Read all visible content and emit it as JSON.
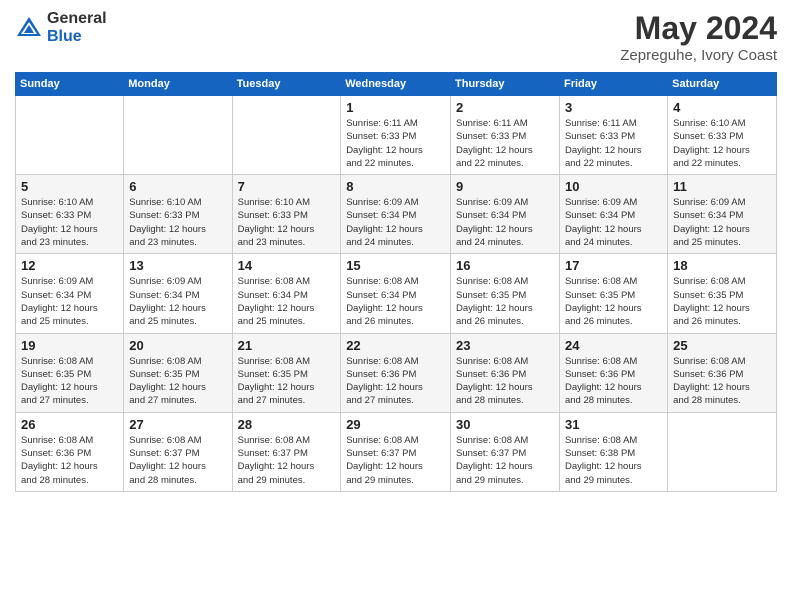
{
  "header": {
    "logo_general": "General",
    "logo_blue": "Blue",
    "month_title": "May 2024",
    "location": "Zepreguhe, Ivory Coast"
  },
  "weekdays": [
    "Sunday",
    "Monday",
    "Tuesday",
    "Wednesday",
    "Thursday",
    "Friday",
    "Saturday"
  ],
  "weeks": [
    [
      {
        "day": "",
        "info": ""
      },
      {
        "day": "",
        "info": ""
      },
      {
        "day": "",
        "info": ""
      },
      {
        "day": "1",
        "info": "Sunrise: 6:11 AM\nSunset: 6:33 PM\nDaylight: 12 hours\nand 22 minutes."
      },
      {
        "day": "2",
        "info": "Sunrise: 6:11 AM\nSunset: 6:33 PM\nDaylight: 12 hours\nand 22 minutes."
      },
      {
        "day": "3",
        "info": "Sunrise: 6:11 AM\nSunset: 6:33 PM\nDaylight: 12 hours\nand 22 minutes."
      },
      {
        "day": "4",
        "info": "Sunrise: 6:10 AM\nSunset: 6:33 PM\nDaylight: 12 hours\nand 22 minutes."
      }
    ],
    [
      {
        "day": "5",
        "info": "Sunrise: 6:10 AM\nSunset: 6:33 PM\nDaylight: 12 hours\nand 23 minutes."
      },
      {
        "day": "6",
        "info": "Sunrise: 6:10 AM\nSunset: 6:33 PM\nDaylight: 12 hours\nand 23 minutes."
      },
      {
        "day": "7",
        "info": "Sunrise: 6:10 AM\nSunset: 6:33 PM\nDaylight: 12 hours\nand 23 minutes."
      },
      {
        "day": "8",
        "info": "Sunrise: 6:09 AM\nSunset: 6:34 PM\nDaylight: 12 hours\nand 24 minutes."
      },
      {
        "day": "9",
        "info": "Sunrise: 6:09 AM\nSunset: 6:34 PM\nDaylight: 12 hours\nand 24 minutes."
      },
      {
        "day": "10",
        "info": "Sunrise: 6:09 AM\nSunset: 6:34 PM\nDaylight: 12 hours\nand 24 minutes."
      },
      {
        "day": "11",
        "info": "Sunrise: 6:09 AM\nSunset: 6:34 PM\nDaylight: 12 hours\nand 25 minutes."
      }
    ],
    [
      {
        "day": "12",
        "info": "Sunrise: 6:09 AM\nSunset: 6:34 PM\nDaylight: 12 hours\nand 25 minutes."
      },
      {
        "day": "13",
        "info": "Sunrise: 6:09 AM\nSunset: 6:34 PM\nDaylight: 12 hours\nand 25 minutes."
      },
      {
        "day": "14",
        "info": "Sunrise: 6:08 AM\nSunset: 6:34 PM\nDaylight: 12 hours\nand 25 minutes."
      },
      {
        "day": "15",
        "info": "Sunrise: 6:08 AM\nSunset: 6:34 PM\nDaylight: 12 hours\nand 26 minutes."
      },
      {
        "day": "16",
        "info": "Sunrise: 6:08 AM\nSunset: 6:35 PM\nDaylight: 12 hours\nand 26 minutes."
      },
      {
        "day": "17",
        "info": "Sunrise: 6:08 AM\nSunset: 6:35 PM\nDaylight: 12 hours\nand 26 minutes."
      },
      {
        "day": "18",
        "info": "Sunrise: 6:08 AM\nSunset: 6:35 PM\nDaylight: 12 hours\nand 26 minutes."
      }
    ],
    [
      {
        "day": "19",
        "info": "Sunrise: 6:08 AM\nSunset: 6:35 PM\nDaylight: 12 hours\nand 27 minutes."
      },
      {
        "day": "20",
        "info": "Sunrise: 6:08 AM\nSunset: 6:35 PM\nDaylight: 12 hours\nand 27 minutes."
      },
      {
        "day": "21",
        "info": "Sunrise: 6:08 AM\nSunset: 6:35 PM\nDaylight: 12 hours\nand 27 minutes."
      },
      {
        "day": "22",
        "info": "Sunrise: 6:08 AM\nSunset: 6:36 PM\nDaylight: 12 hours\nand 27 minutes."
      },
      {
        "day": "23",
        "info": "Sunrise: 6:08 AM\nSunset: 6:36 PM\nDaylight: 12 hours\nand 28 minutes."
      },
      {
        "day": "24",
        "info": "Sunrise: 6:08 AM\nSunset: 6:36 PM\nDaylight: 12 hours\nand 28 minutes."
      },
      {
        "day": "25",
        "info": "Sunrise: 6:08 AM\nSunset: 6:36 PM\nDaylight: 12 hours\nand 28 minutes."
      }
    ],
    [
      {
        "day": "26",
        "info": "Sunrise: 6:08 AM\nSunset: 6:36 PM\nDaylight: 12 hours\nand 28 minutes."
      },
      {
        "day": "27",
        "info": "Sunrise: 6:08 AM\nSunset: 6:37 PM\nDaylight: 12 hours\nand 28 minutes."
      },
      {
        "day": "28",
        "info": "Sunrise: 6:08 AM\nSunset: 6:37 PM\nDaylight: 12 hours\nand 29 minutes."
      },
      {
        "day": "29",
        "info": "Sunrise: 6:08 AM\nSunset: 6:37 PM\nDaylight: 12 hours\nand 29 minutes."
      },
      {
        "day": "30",
        "info": "Sunrise: 6:08 AM\nSunset: 6:37 PM\nDaylight: 12 hours\nand 29 minutes."
      },
      {
        "day": "31",
        "info": "Sunrise: 6:08 AM\nSunset: 6:38 PM\nDaylight: 12 hours\nand 29 minutes."
      },
      {
        "day": "",
        "info": ""
      }
    ]
  ]
}
